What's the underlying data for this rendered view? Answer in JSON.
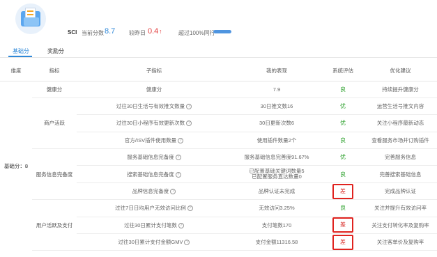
{
  "header": {
    "brand": "SCI",
    "score_label": "当前分数",
    "score_value": "8.7",
    "beat_label": "较昨日",
    "beat_value": "0.4",
    "peer_text": "超过100%同行",
    "peer_progress": 1.0
  },
  "tabs": [
    {
      "label": "基础分"
    },
    {
      "label": "奖励分"
    }
  ],
  "table": {
    "headers": [
      "维度",
      "指标",
      "子指标",
      "我的表现",
      "系统评估",
      "优化建议"
    ],
    "dimension": "基础分：8",
    "groups": {
      "health": "健康分",
      "merchant": "商户活跃",
      "service": "服务信息完备度",
      "users": "用户活跃及支付"
    },
    "rows": [
      {
        "sub": "健康分",
        "q": false,
        "perf": "7.9",
        "eval": "良",
        "advice": "持续提升健康分"
      },
      {
        "sub": "过往30日生活号有效推文数量",
        "q": true,
        "perf": "30日推文数16",
        "eval": "优",
        "advice": "运营生活号推文内容"
      },
      {
        "sub": "过往30日小程序有效更新次数",
        "q": true,
        "perf": "30日更新次数6",
        "eval": "优",
        "advice": "关注小程序最新动态"
      },
      {
        "sub": "官方/ISV插件使用数量",
        "q": true,
        "perf": "使用插件数量2个",
        "eval": "良",
        "advice": "查看服务市场并订购插件"
      },
      {
        "sub": "服务基础信息完备度",
        "q": true,
        "perf": "服务基础信息完善度91.67%",
        "eval": "优",
        "advice": "完善服务信息"
      },
      {
        "sub": "搜索基础信息完备度",
        "q": true,
        "perf_line1": "已配置基础关键词数量5",
        "perf_line2": "已配置服务直达数量0",
        "eval": "良",
        "advice": "完善搜索基础信息"
      },
      {
        "sub": "品牌信息完备度",
        "q": true,
        "perf": "品牌认证未完成",
        "eval": "差",
        "advice": "完成品牌认证"
      },
      {
        "sub": "过往7日日均用户无效访问比例",
        "q": true,
        "perf": "无效访问3.25%",
        "eval": "良",
        "advice": "关注并提升有效访问率"
      },
      {
        "sub": "过往30日累计支付笔数",
        "q": true,
        "perf": "支付笔数170",
        "eval": "差",
        "advice": "关注支付转化率及复购率"
      },
      {
        "sub": "过往30日累计支付金额GMV",
        "q": true,
        "perf": "支付金额11316.58",
        "eval": "差",
        "advice": "关注客单价及复购率"
      }
    ]
  },
  "colors": {
    "accent": "#2f88d8",
    "good": "#2ea12e",
    "bad": "#d9302c",
    "highlight_box": "#e0231f"
  }
}
